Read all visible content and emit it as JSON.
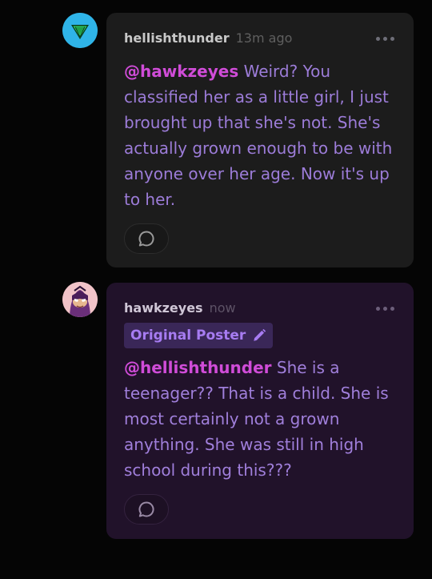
{
  "comments": [
    {
      "username": "hellishthunder",
      "time": "13m ago",
      "mention": "@hawkzeyes",
      "text": " Weird? You classified her as a little girl, I just brought up that she's not. She's actually grown enough to be with anyone over her age. Now it's up to her.",
      "avatar_icon": "green-triangle-gem-avatar",
      "more_icon": "ellipsis-icon",
      "reply_icon": "speech-bubble-icon"
    },
    {
      "username": "hawkzeyes",
      "time": "now",
      "badge": "Original Poster",
      "badge_icon": "pencil-icon",
      "mention": "@hellishthunder",
      "text": " She is a teenager?? That is a child. She is most certainly not a grown anything. She was still in high school during this???",
      "avatar_icon": "hawkeye-masked-face-avatar",
      "more_icon": "ellipsis-icon",
      "reply_icon": "speech-bubble-icon"
    }
  ],
  "colors": {
    "background": "#050505",
    "card_default": "#1c1c1c",
    "card_op": "#21122a",
    "mention": "#d04cd8",
    "body_text": "#9c7cd8",
    "badge_bg": "#3a2758",
    "badge_text": "#a77cf2"
  }
}
